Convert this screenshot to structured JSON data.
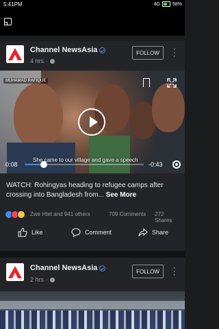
{
  "status_bar": {
    "time": "5:41PM",
    "signal": "4G",
    "battery": "58%"
  },
  "post1": {
    "channel": "Channel NewsAsia",
    "age": "4 hrs",
    "follow_label": "FOLLOW",
    "video": {
      "credit": "MUHAMAD RAFIQUE",
      "subtitle": "She came to our village and gave a speech",
      "elapsed": "0:08",
      "remaining": "-0:43",
      "progress_fraction": 0.16
    },
    "caption": "WATCH: Rohingyas heading to refugee camps after crossing into Bangladesh from...",
    "see_more": "See More",
    "reactions_summary": "Zwe Htet and 941 others",
    "comments_count": "709 Comments",
    "shares_count": "272 Shares",
    "actions": {
      "like": "Like",
      "comment": "Comment",
      "share": "Share"
    }
  },
  "post2": {
    "channel": "Channel NewsAsia",
    "age": "2 hrs",
    "follow_label": "FOLLOW"
  },
  "colors": {
    "background": "#1b1c1e",
    "card": "#232427",
    "accent_blue": "#3d8bff",
    "logo_red": "#e8262d"
  }
}
